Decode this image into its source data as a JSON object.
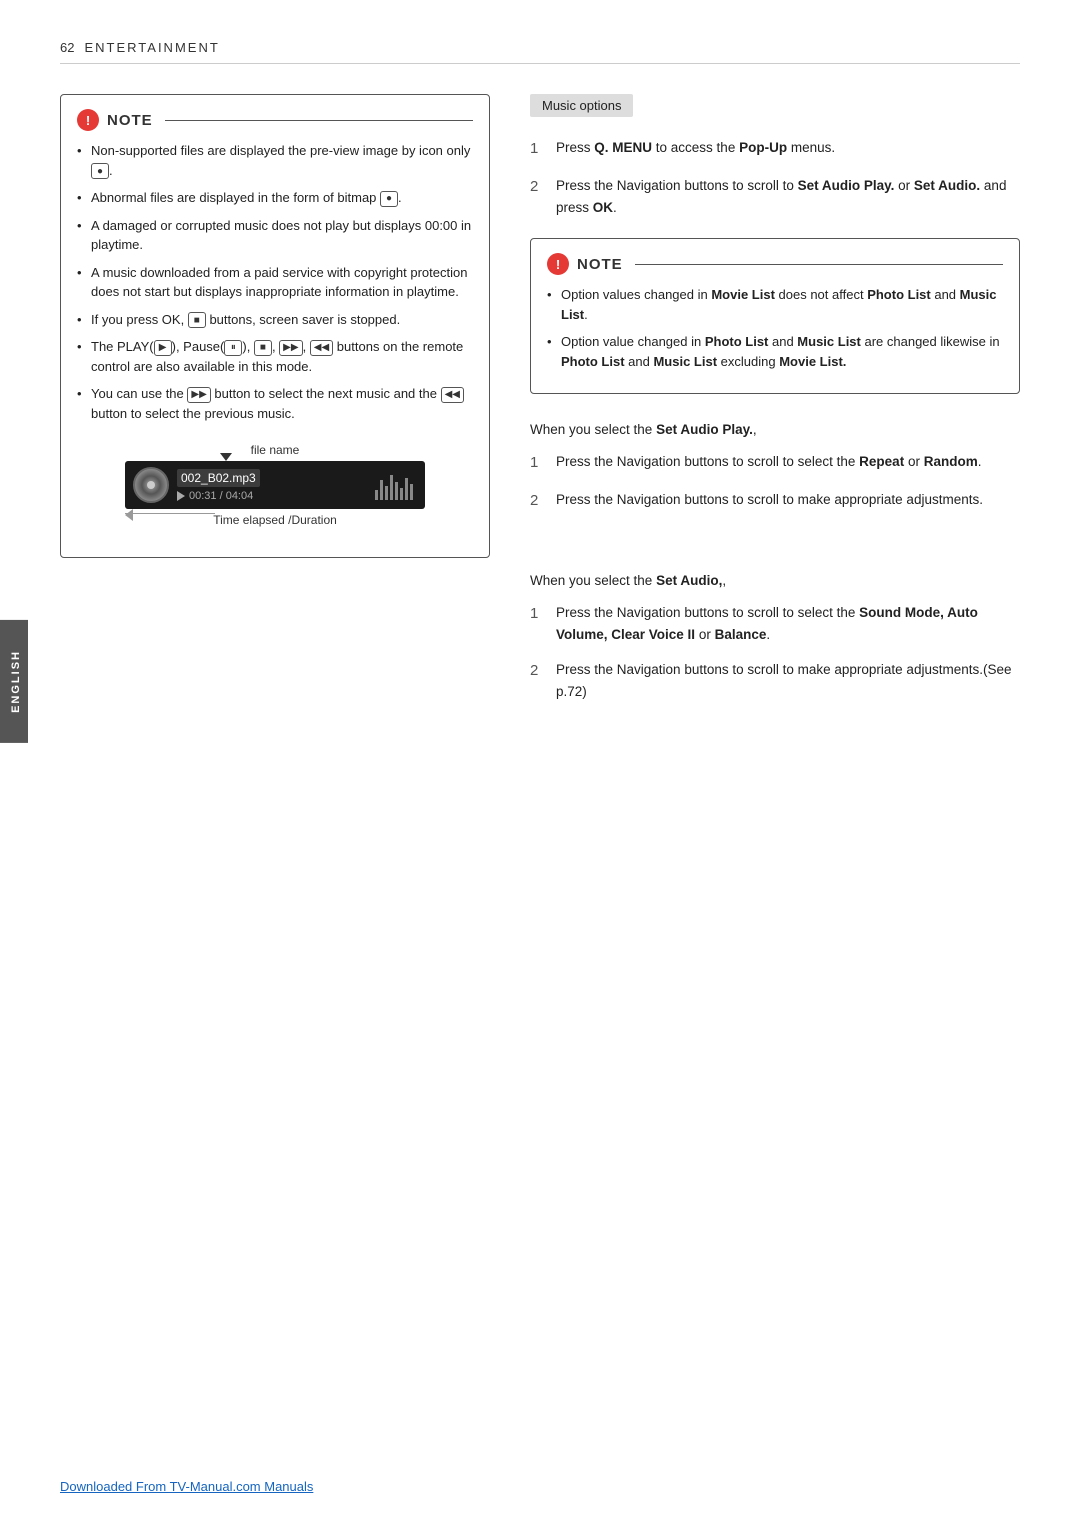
{
  "page": {
    "number": "62",
    "section": "ENTERTAINMENT"
  },
  "sidebar": {
    "label": "ENGLISH"
  },
  "footer": {
    "link_text": "Downloaded From TV-Manual.com Manuals"
  },
  "left_note": {
    "title": "NOTE",
    "items": [
      "Non-supported files are displayed the preview image by icon only",
      "Abnormal files are displayed in the form of bitmap",
      "A damaged or corrupted music does not play but displays 00:00 in playtime.",
      "A music downloaded from a paid service with copyright protection does not start but displays inappropriate information in playtime.",
      "If you press OK, buttons, screen saver is stopped.",
      "The PLAY(▶), Pause(⏸), ■, ▶▶, ◀◀ buttons on the remote control are also available in this mode.",
      "You can use the ▶▶ button to select the next music and the ◀◀ button to select the previous music."
    ],
    "player": {
      "filename_label": "file name",
      "filename": "002_B02.mp3",
      "time": "▶ 00:31 / 04:04",
      "time_label": "Time elapsed /Duration"
    }
  },
  "right": {
    "music_options_label": "Music options",
    "step1_main": "Press ",
    "step1_qmenu": "Q. MENU",
    "step1_mid": " to access the ",
    "step1_popup": "Pop-Up",
    "step1_end": " menus.",
    "step2_start": "Press the Navigation buttons to scroll to ",
    "step2_bold1": "Set Audio Play.",
    "step2_mid": " or ",
    "step2_bold2": "Set Audio.",
    "step2_end": " and press ",
    "step2_ok": "OK",
    "step2_period": ".",
    "right_note": {
      "title": "NOTE",
      "items": [
        {
          "text_start": "Option values changed in ",
          "bold1": "Movie List",
          "text_mid": " does not affect ",
          "bold2": "Photo List",
          "text_mid2": " and ",
          "bold3": "Music List",
          "text_end": "."
        },
        {
          "text_start": "Option value changed in ",
          "bold1": "Photo List",
          "text_mid": " and ",
          "bold2": "Music List",
          "text_mid2": " are changed likewise in ",
          "bold3": "Photo List",
          "text_mid3": " and ",
          "bold4": "Music List",
          "text_mid4": " excluding ",
          "bold5": "Movie List.",
          "text_end": ""
        }
      ]
    },
    "set_audio_play_section": {
      "intro": "When you select the ",
      "intro_bold": "Set Audio Play.",
      "intro_end": ",",
      "steps": [
        {
          "num": "1",
          "text_start": "Press the Navigation buttons to scroll to select the ",
          "bold1": "Repeat",
          "text_mid": " or ",
          "bold2": "Random",
          "text_end": "."
        },
        {
          "num": "2",
          "text": "Press the Navigation buttons to scroll to make appropriate adjustments."
        }
      ]
    },
    "set_audio_section": {
      "intro": "When you select the ",
      "intro_bold": "Set Audio,",
      "intro_end": ",",
      "steps": [
        {
          "num": "1",
          "text_start": "Press the Navigation buttons to scroll to select the ",
          "bold1": "Sound Mode, Auto Volume, Clear Voice II",
          "text_mid": " or ",
          "bold2": "Balance",
          "text_end": "."
        },
        {
          "num": "2",
          "text": "Press the Navigation buttons to scroll to make appropriate adjustments.(See p.72)"
        }
      ]
    }
  }
}
